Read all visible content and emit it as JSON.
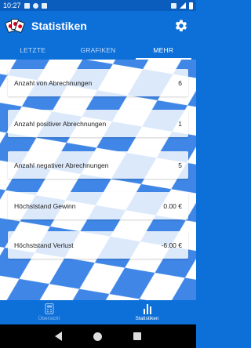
{
  "status_bar": {
    "time": "10:27"
  },
  "app_bar": {
    "title": "Statistiken"
  },
  "tabs": [
    {
      "label": "LETZTE"
    },
    {
      "label": "GRAFIKEN"
    },
    {
      "label": "MEHR"
    }
  ],
  "stats": [
    {
      "label": "Anzahl von Abrechnungen",
      "value": "6"
    },
    {
      "label": "Anzahl positiver Abrechnungen",
      "value": "1"
    },
    {
      "label": "Anzahl negativer Abrechnungen",
      "value": "5"
    },
    {
      "label": "Höchststand Gewinn",
      "value": "0.00 €"
    },
    {
      "label": "Höchststand Verlust",
      "value": "-6.00 €"
    }
  ],
  "bottom_nav": [
    {
      "label": "Übersicht"
    },
    {
      "label": "Statistiken"
    }
  ],
  "colors": {
    "primary": "#0d6fd8",
    "pattern_blue": "#3f86e6",
    "pattern_white": "#ffffff"
  }
}
